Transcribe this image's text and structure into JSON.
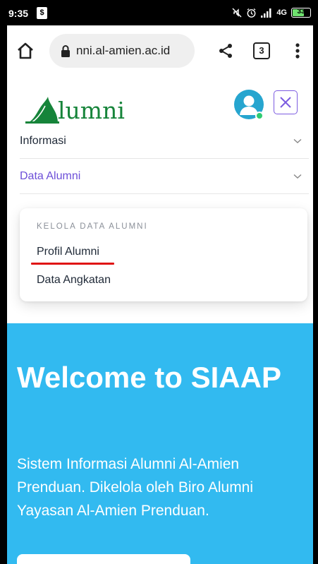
{
  "status_bar": {
    "time": "9:35",
    "network": "4G",
    "battery": "33",
    "accent": "#6ee16e"
  },
  "browser": {
    "url": "nni.al-amien.ac.id",
    "tab_count": "3"
  },
  "site": {
    "logo_text": "lumni",
    "brand_color": "#16843a",
    "accent_purple": "#6d4fd8"
  },
  "nav": {
    "items": [
      {
        "label": "Informasi"
      },
      {
        "label": "Data Alumni"
      }
    ]
  },
  "dropdown": {
    "heading": "KELOLA DATA ALUMNI",
    "items": [
      {
        "label": "Profil Alumni"
      },
      {
        "label": "Data Angkatan"
      }
    ]
  },
  "hero": {
    "title": "Welcome to SIAAP",
    "description": "Sistem Informasi Alumni Al-Amien Prenduan. Dikelola oleh Biro Alumni Yayasan Al-Amien Prenduan.",
    "background": "#32baf0"
  }
}
